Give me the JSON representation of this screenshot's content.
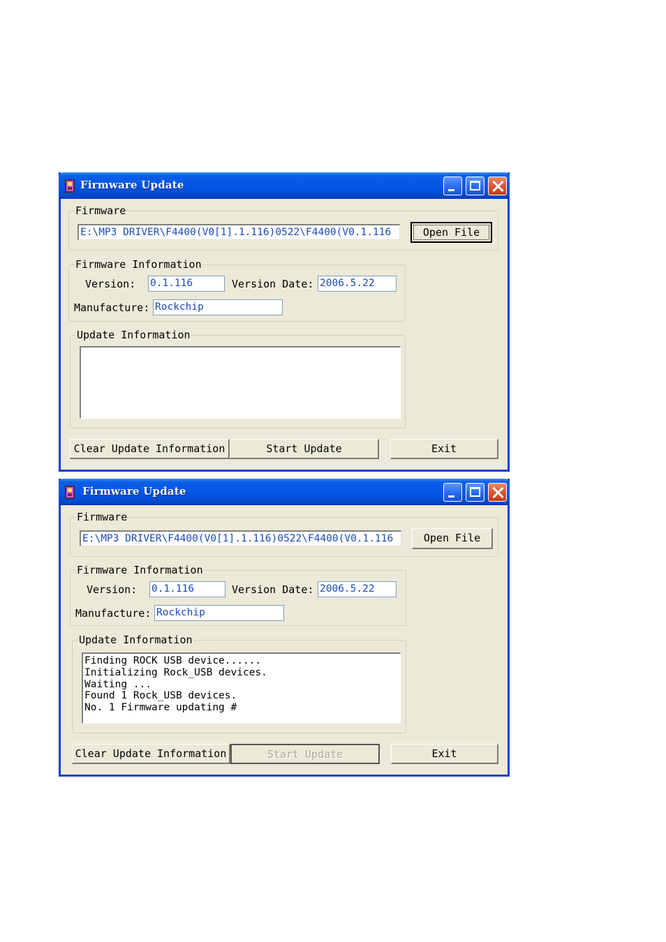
{
  "windows": [
    {
      "title": "Firmware Update",
      "firmware_group_label": "Firmware",
      "firmware_path": "E:\\MP3 DRIVER\\F4400(V0[1].1.116)0522\\F4400(V0.1.116",
      "open_file_label": "Open File",
      "info_group_label": "Firmware Information",
      "version_label": "Version:",
      "version_value": "0.1.116",
      "version_date_label": "Version Date:",
      "version_date_value": "2006.5.22",
      "manufacture_label": "Manufacture:",
      "manufacture_value": "Rockchip",
      "update_group_label": "Update Information",
      "update_log": "",
      "clear_label": "Clear Update Information",
      "start_label": "Start Update",
      "exit_label": "Exit"
    },
    {
      "title": "Firmware Update",
      "firmware_group_label": "Firmware",
      "firmware_path": "E:\\MP3 DRIVER\\F4400(V0[1].1.116)0522\\F4400(V0.1.116",
      "open_file_label": "Open File",
      "info_group_label": "Firmware Information",
      "version_label": "Version:",
      "version_value": "0.1.116",
      "version_date_label": "Version Date:",
      "version_date_value": "2006.5.22",
      "manufacture_label": "Manufacture:",
      "manufacture_value": "Rockchip",
      "update_group_label": "Update Information",
      "update_log": "Finding ROCK USB device......\nInitializing Rock_USB devices.\nWaiting ...\nFound 1 Rock_USB devices.\nNo. 1 Firmware updating #",
      "clear_label": "Clear Update Information",
      "start_label": "Start Update",
      "exit_label": "Exit"
    }
  ],
  "icons": {
    "app": "app-icon",
    "minimize": "minimize-icon",
    "maximize": "maximize-icon",
    "close": "close-icon"
  },
  "colors": {
    "titlebar": "#0355e3",
    "dialog_bg": "#ece9d8",
    "field_text": "#1a4ab8",
    "close_button": "#e05a33"
  }
}
